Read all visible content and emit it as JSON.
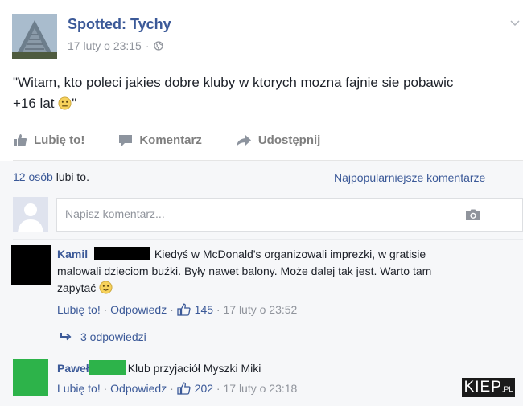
{
  "post": {
    "page_name": "Spotted: Tychy",
    "timestamp": "17 luty o 23:15",
    "text_part1": "\"Witam, kto poleci jakies dobre kluby w ktorych mozna fajnie sie pobawic",
    "text_part2": "+16 lat",
    "text_part3": "\""
  },
  "actions": {
    "like": "Lubię to!",
    "comment": "Komentarz",
    "share": "Udostępnij"
  },
  "stats": {
    "likes_count": "12 osób",
    "likes_rest": " lubi to.",
    "sort_label": "Najpopularniejsze komentarze"
  },
  "composer": {
    "placeholder": "Napisz komentarz..."
  },
  "comments": [
    {
      "author": "Kamil",
      "text_a": "Kiedyś w McDonald's organizowali imprezki, w gratisie",
      "text_b": "malowali dzieciom buźki. Były nawet balony. Może dalej tak jest. Warto tam",
      "text_c": "zapytać",
      "like_label": "Lubię to!",
      "reply_label": "Odpowiedz",
      "likes": "145",
      "time": "17 luty o 23:52",
      "replies": "3 odpowiedzi"
    },
    {
      "author": "Paweł",
      "text_a": "Klub przyjaciół Myszki Miki",
      "like_label": "Lubię to!",
      "reply_label": "Odpowiedz",
      "likes": "202",
      "time": "17 luty o 23:18"
    }
  ],
  "watermark": {
    "main": "KIEP",
    "suffix": ".PL"
  },
  "colors": {
    "link": "#3b5998",
    "muted": "#90949c",
    "panel": "#f6f7f9",
    "censor_black": "#000000",
    "censor_green": "#2db34a"
  }
}
